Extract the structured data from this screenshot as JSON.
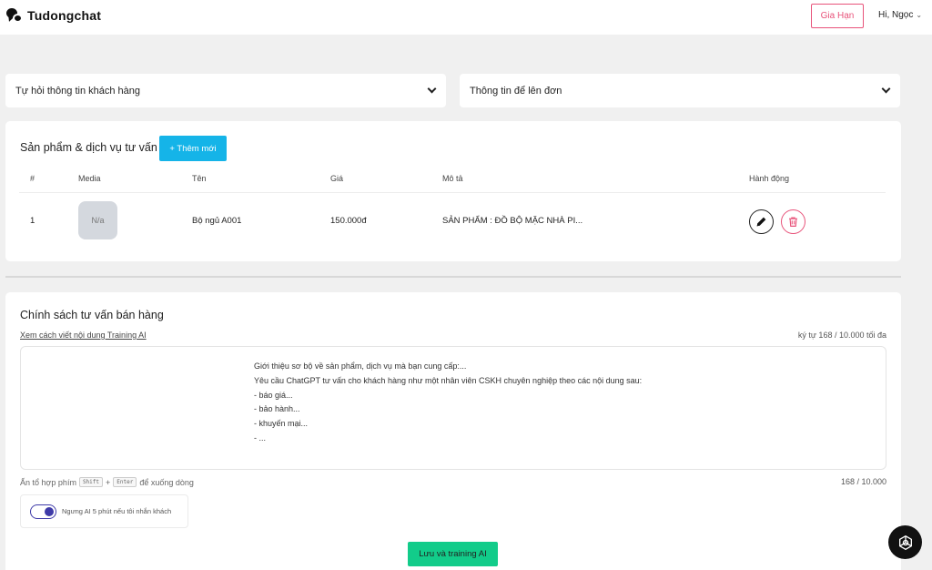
{
  "app": {
    "name": "Tudongchat"
  },
  "header": {
    "renew_label": "Gia Hạn",
    "greeting": "Hi, Ngọc"
  },
  "selects": [
    {
      "label": "Tự hỏi thông tin khách hàng"
    },
    {
      "label": "Thông tin để lên đơn"
    }
  ],
  "products": {
    "title": "Sản phẩm & dịch vụ tư vấn",
    "add_label": "+ Thêm mới",
    "columns": [
      "#",
      "Media",
      "Tên",
      "Giá",
      "Mô tả",
      "Hành động"
    ],
    "rows": [
      {
        "index": "1",
        "media": "N/a",
        "name": "Bộ ngủ A001",
        "price": "150.000đ",
        "description": "SẢN PHẨM : ĐỒ BỘ MẶC NHÀ PI..."
      }
    ]
  },
  "policy": {
    "title": "Chính sách tư vấn bán hàng",
    "guide_link": "Xem cách viết nội dung Training AI",
    "char_limit_text": "ký tự 168 / 10.000 tối đa",
    "content": "Giới thiệu sơ bộ về sản phẩm, dịch vụ mà bạn cung cấp:...\nYêu cầu ChatGPT tư vấn cho khách hàng như một nhân viên CSKH chuyên nghiệp theo các nội dung sau:\n- báo giá...\n- bảo hành...\n- khuyến mại...\n- ...",
    "hint_prefix": "Ấn tổ hợp phím",
    "hint_key1": "Shift",
    "hint_plus": "+",
    "hint_key2": "Enter",
    "hint_suffix": "để xuống dòng",
    "char_count": "168 / 10.000",
    "toggle_label": "Ngưng AI 5 phút nếu tôi nhắn khách",
    "toggle_on": true,
    "save_label": "Lưu và training AI"
  },
  "colors": {
    "accent_pink": "#e8537a",
    "add_button": "#15b4e8",
    "save_button": "#12cc8a",
    "toggle": "#3e3aa8"
  },
  "icons": {
    "logo": "chat-bubbles-icon",
    "edit": "pencil-icon",
    "delete": "trash-icon",
    "fab": "openai-icon",
    "dropdown": "chevron-down-icon"
  }
}
